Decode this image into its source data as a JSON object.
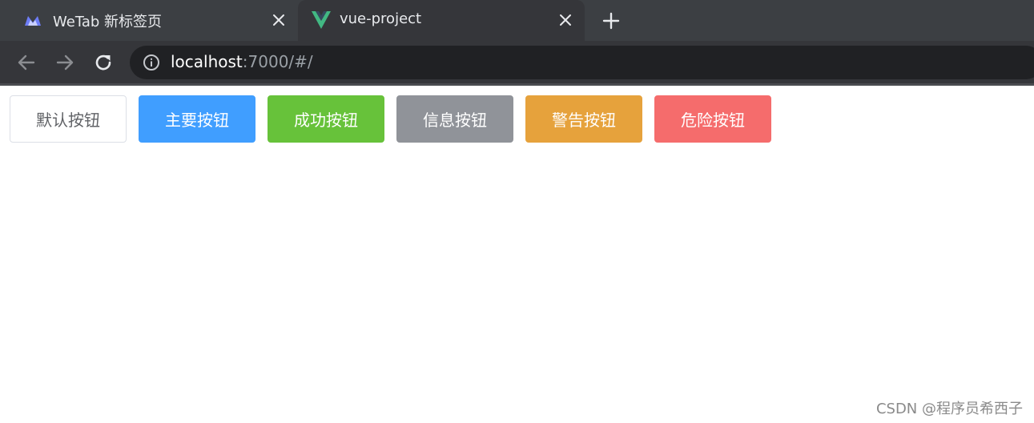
{
  "browser": {
    "tabs": [
      {
        "title": "WeTab 新标签页",
        "icon": "wetab-logo-icon",
        "active": false
      },
      {
        "title": "vue-project",
        "icon": "vue-logo-icon",
        "active": true
      }
    ],
    "address": {
      "host": "localhost",
      "rest": ":7000/#/"
    }
  },
  "buttons": {
    "default": "默认按钮",
    "primary": "主要按钮",
    "success": "成功按钮",
    "info": "信息按钮",
    "warning": "警告按钮",
    "danger": "危险按钮"
  },
  "colors": {
    "default": "#ffffff",
    "primary": "#409eff",
    "success": "#67c23a",
    "info": "#909399",
    "warning": "#e6a23c",
    "danger": "#f56c6c"
  },
  "watermark": "CSDN @程序员希西子"
}
